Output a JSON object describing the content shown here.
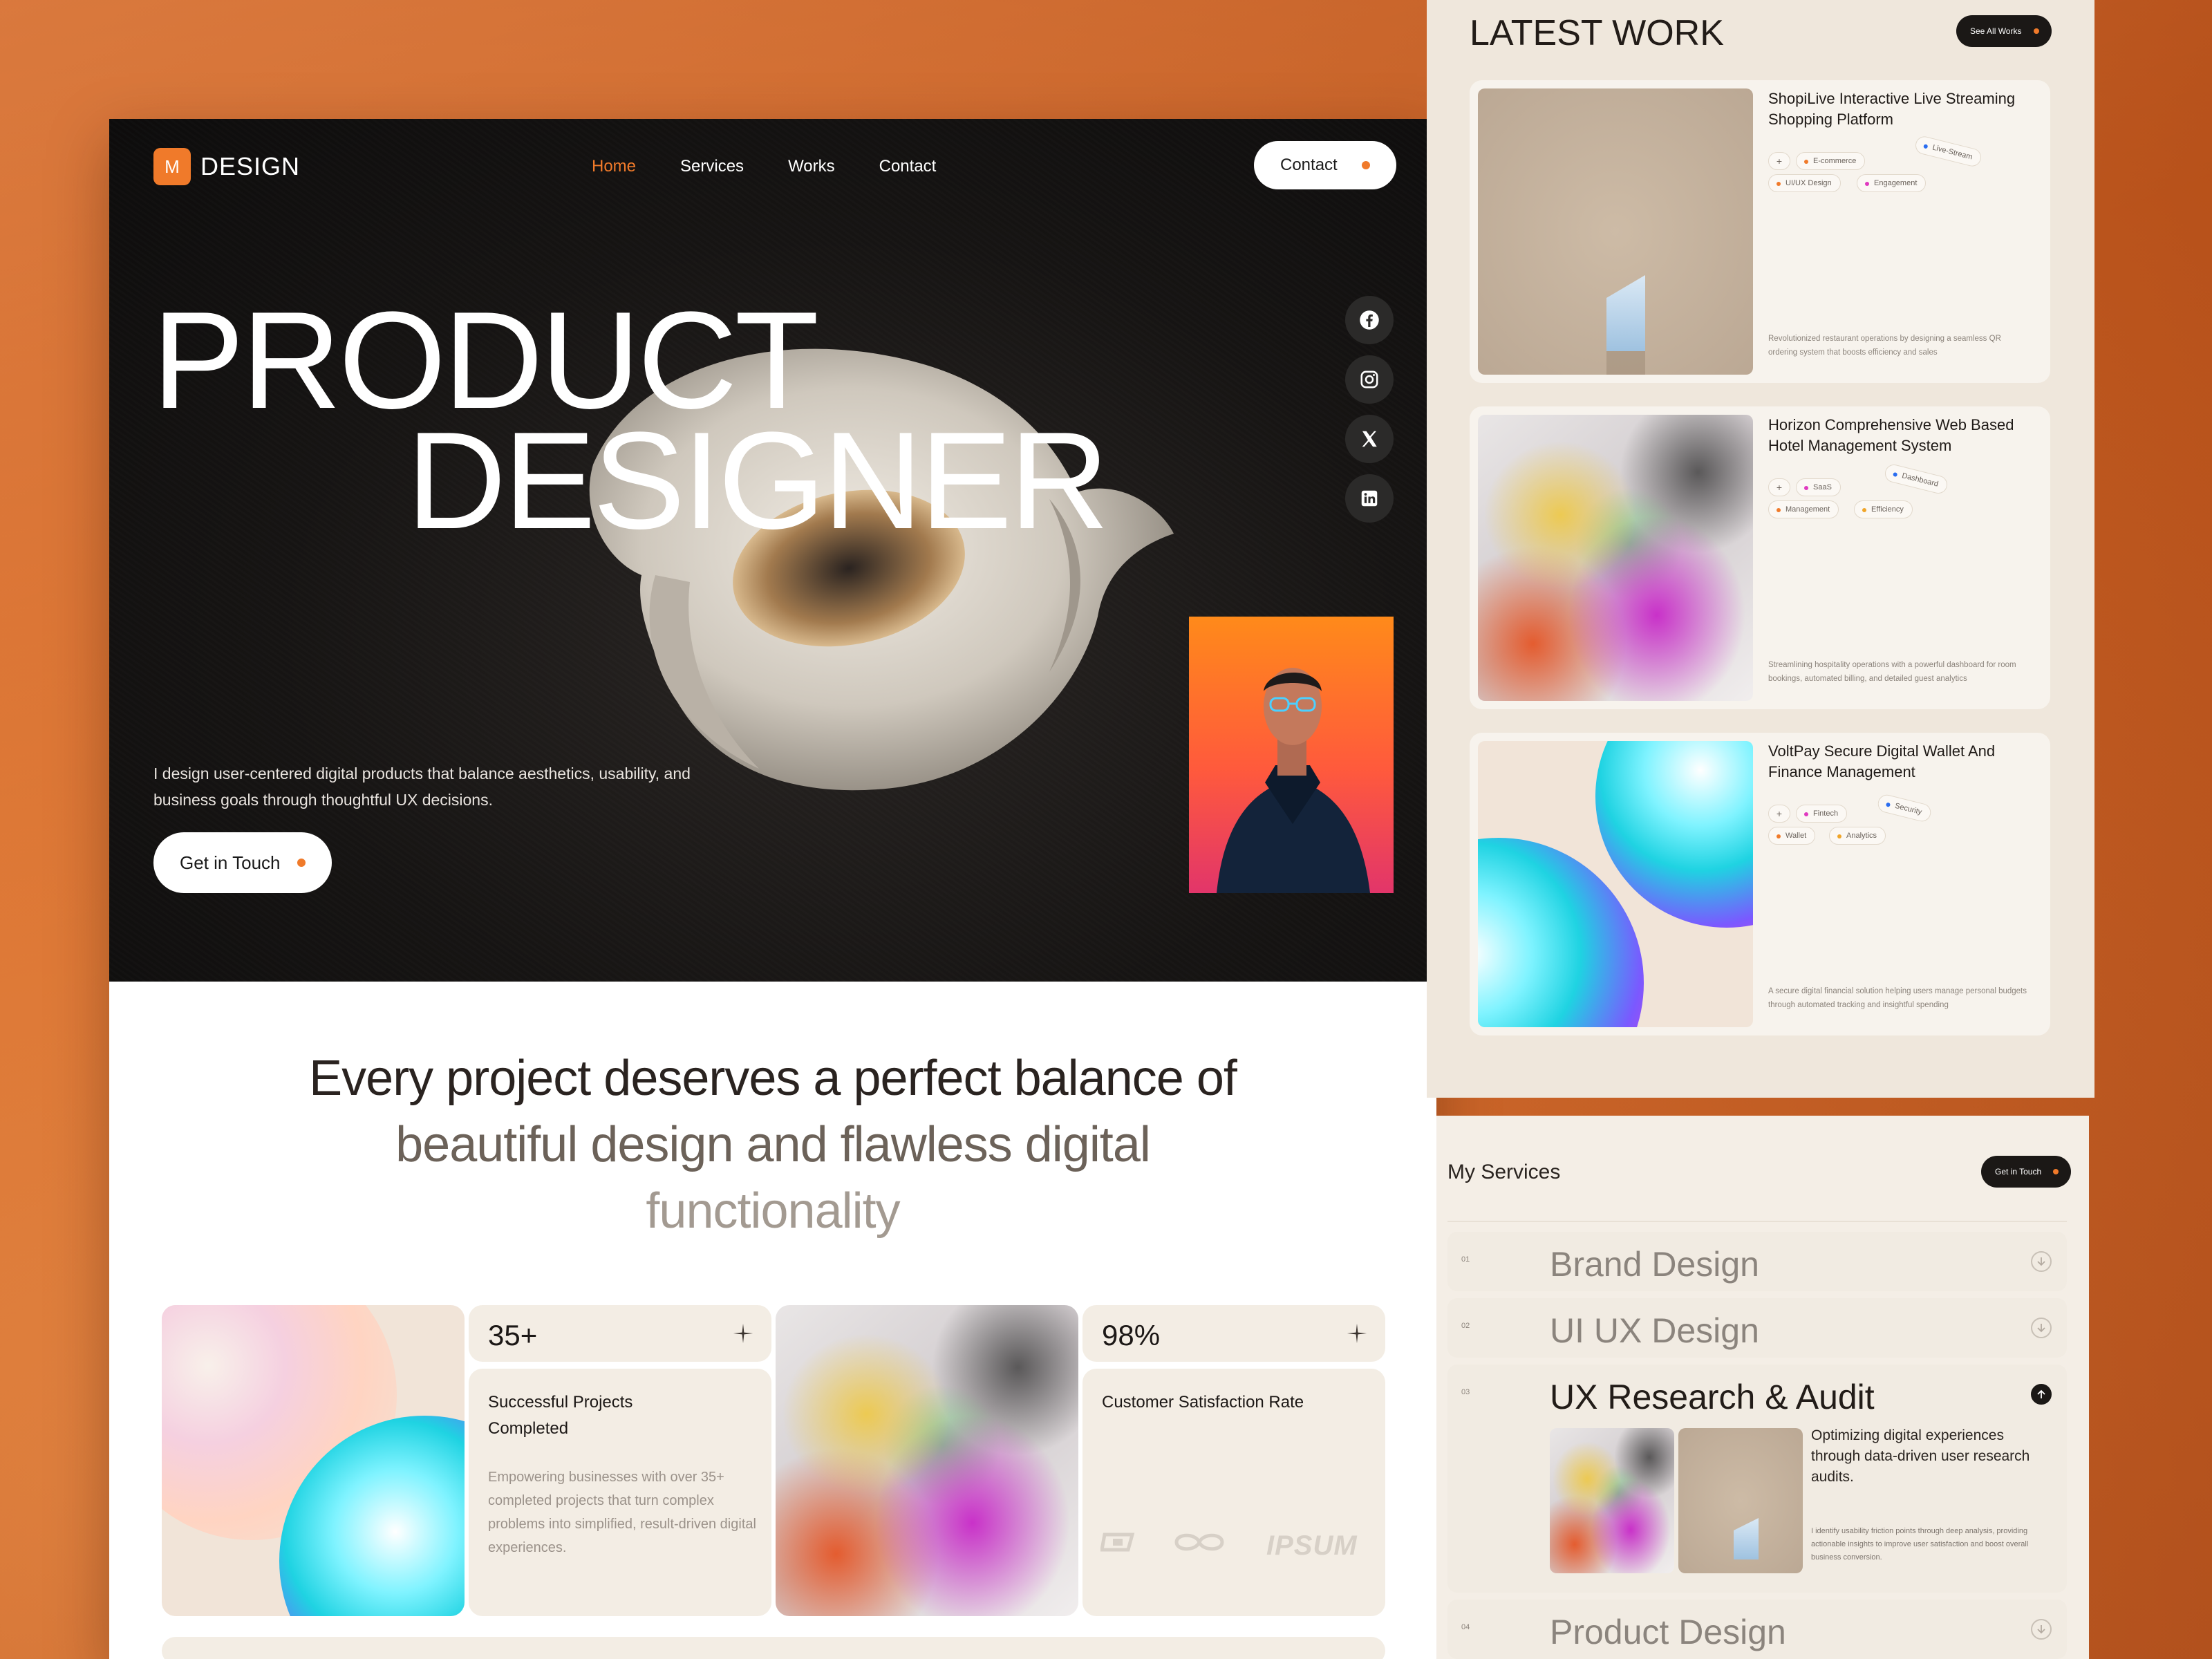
{
  "brand": {
    "badge": "M",
    "name": "DESIGN"
  },
  "nav": {
    "items": [
      "Home",
      "Services",
      "Works",
      "Contact"
    ],
    "active": "Home",
    "cta": "Contact"
  },
  "hero": {
    "title_line1": "PRODUCT",
    "title_line2": "DESIGNER",
    "description": "I design user-centered digital products that balance aesthetics, usability, and business goals through thoughtful UX decisions.",
    "cta": "Get in Touch"
  },
  "social": [
    "facebook-icon",
    "instagram-icon",
    "x-icon",
    "linkedin-icon"
  ],
  "statement": {
    "line1": "Every project deserves a perfect balance of",
    "line2": "beautiful design and flawless digital",
    "line3": "functionality"
  },
  "stats": [
    {
      "value": "35+",
      "label": "Successful Projects Completed",
      "description": "Empowering businesses with over 35+ completed projects that turn complex problems into simplified, result-driven digital experiences."
    },
    {
      "value": "98%",
      "label": "Customer Satisfaction Rate"
    }
  ],
  "client_logos": [
    "IPSUM"
  ],
  "latest_work": {
    "title": "LATEST WORK",
    "see_all": "See All Works",
    "projects": [
      {
        "name": "ShopiLive Interactive Live Streaming Shopping Platform",
        "tags": [
          "E-commerce",
          "Live-Stream",
          "UI/UX Design",
          "Engagement"
        ],
        "description": "Revolutionized restaurant operations by designing a seamless QR ordering system that boosts efficiency and sales"
      },
      {
        "name": "Horizon Comprehensive Web Based Hotel Management System",
        "tags": [
          "SaaS",
          "Dashboard",
          "Management",
          "Efficiency"
        ],
        "description": "Streamlining hospitality operations with a powerful dashboard for room bookings, automated billing, and detailed guest analytics"
      },
      {
        "name": "VoltPay Secure Digital Wallet And Finance Management",
        "tags": [
          "Fintech",
          "Security",
          "Wallet",
          "Analytics"
        ],
        "description": "A secure digital financial solution helping users manage personal budgets through automated tracking and insightful spending"
      }
    ]
  },
  "services": {
    "title": "My Services",
    "cta": "Get in Touch",
    "items": [
      {
        "num": "01",
        "name": "Brand Design"
      },
      {
        "num": "02",
        "name": "UI UX Design"
      },
      {
        "num": "03",
        "name": "UX Research & Audit",
        "lead": "Optimizing digital experiences through data-driven user research audits.",
        "description": "I identify usability friction points through deep analysis, providing actionable insights to improve user satisfaction and boost overall business conversion."
      },
      {
        "num": "04",
        "name": "Product Design"
      }
    ]
  },
  "colors": {
    "accent": "#f07a2a",
    "dark": "#1b1816",
    "beige": "#f3ede4"
  }
}
